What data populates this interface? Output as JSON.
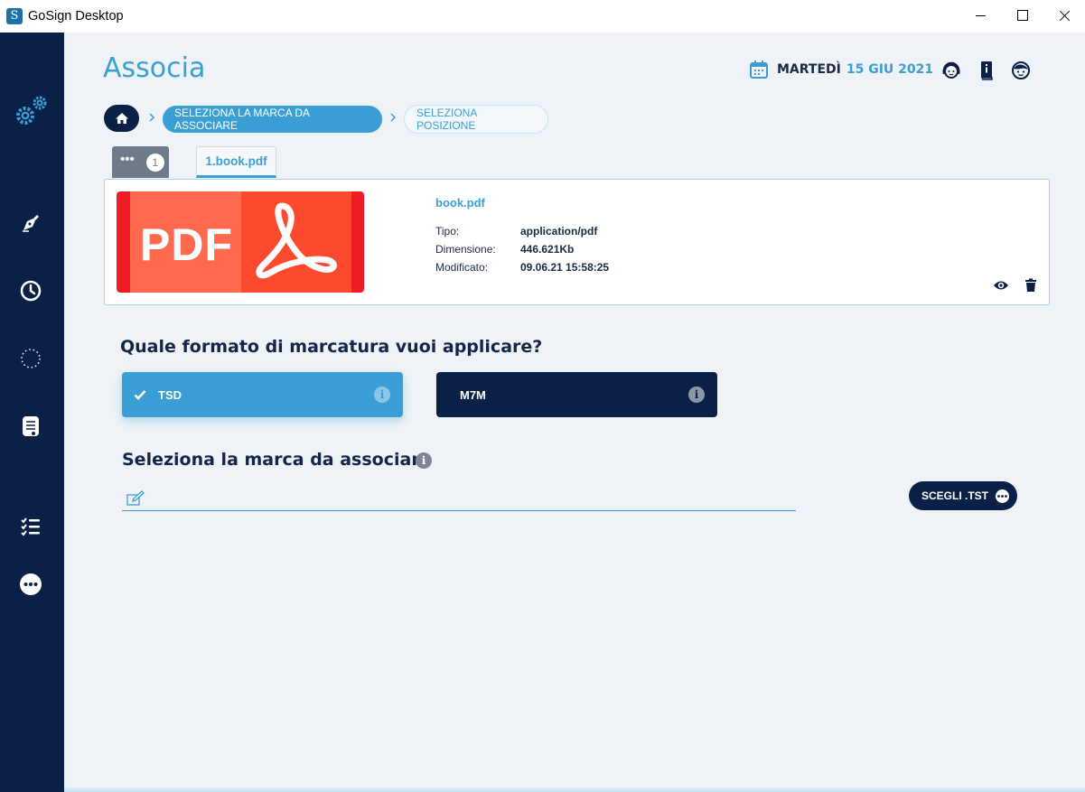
{
  "window": {
    "title": "GoSign Desktop",
    "logo_letter": "S"
  },
  "sidebar": {
    "items": [
      {
        "name": "settings",
        "icon": "gears-icon"
      },
      {
        "name": "sign",
        "icon": "pen-nib-icon"
      },
      {
        "name": "history",
        "icon": "clock-icon"
      },
      {
        "name": "processes",
        "icon": "dotted-circle-icon"
      },
      {
        "name": "archive",
        "icon": "document-icon"
      },
      {
        "name": "list",
        "icon": "checklist-icon"
      },
      {
        "name": "more",
        "icon": "more-dots-icon"
      }
    ]
  },
  "header": {
    "page_title": "Associa",
    "date_day": "MARTEDÌ",
    "date_date": "15 GIU 2021",
    "icons": [
      "support-icon",
      "manual-icon",
      "profile-icon"
    ]
  },
  "breadcrumb": {
    "home_icon": "home-icon",
    "steps": [
      {
        "label": "SELEZIONA LA MARCA DA ASSOCIARE",
        "active": true
      },
      {
        "label": "SELEZIONA POSIZIONE",
        "active": false
      }
    ]
  },
  "tabs": {
    "more_label": "•••",
    "count": "1",
    "file_tab_label": "1.book.pdf"
  },
  "file": {
    "thumbnail_text": "PDF",
    "name": "book.pdf",
    "meta": [
      {
        "label": "Tipo:",
        "value": "application/pdf"
      },
      {
        "label": "Dimensione:",
        "value": "446.621Kb"
      },
      {
        "label": "Modificato:",
        "value": "09.06.21 15:58:25"
      }
    ],
    "actions": [
      "eye-icon",
      "trash-icon"
    ]
  },
  "format": {
    "question": "Quale formato di marcatura vuoi applicare?",
    "options": [
      {
        "label": "TSD",
        "selected": true
      },
      {
        "label": "M7M",
        "selected": false
      }
    ]
  },
  "select_mark": {
    "title": "Seleziona la marca da associare",
    "input_value": "",
    "button_label": "SCEGLI .TST"
  },
  "colors": {
    "sidebar": "#0b2046",
    "accent": "#3a9fd4",
    "background": "#eff3f7"
  }
}
